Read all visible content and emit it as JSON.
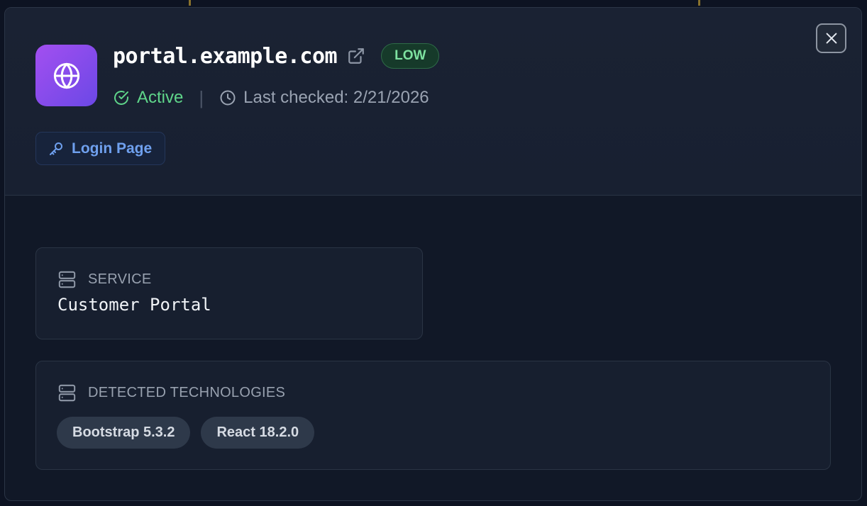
{
  "asset": {
    "hostname": "portal.example.com",
    "risk_badge": "LOW",
    "status": "Active",
    "last_checked": "Last checked: 2/21/2026",
    "tag_label": "Login Page"
  },
  "service_card": {
    "label": "SERVICE",
    "value": "Customer Portal"
  },
  "tech_card": {
    "label": "DETECTED TECHNOLOGIES",
    "technologies": [
      "Bootstrap 5.3.2",
      "React 18.2.0"
    ]
  },
  "icons": {
    "app": "globe-icon",
    "external": "external-link-icon",
    "status": "check-circle-icon",
    "clock": "clock-icon",
    "tag": "key-icon",
    "close": "close-icon",
    "card": "server-icon"
  },
  "colors": {
    "app_icon_gradient": [
      "#a34ff0",
      "#6b48e6"
    ],
    "status_active": "#5fd58a",
    "badge_low": "#7ee2a0",
    "accent_link": "#6fa0ee"
  }
}
